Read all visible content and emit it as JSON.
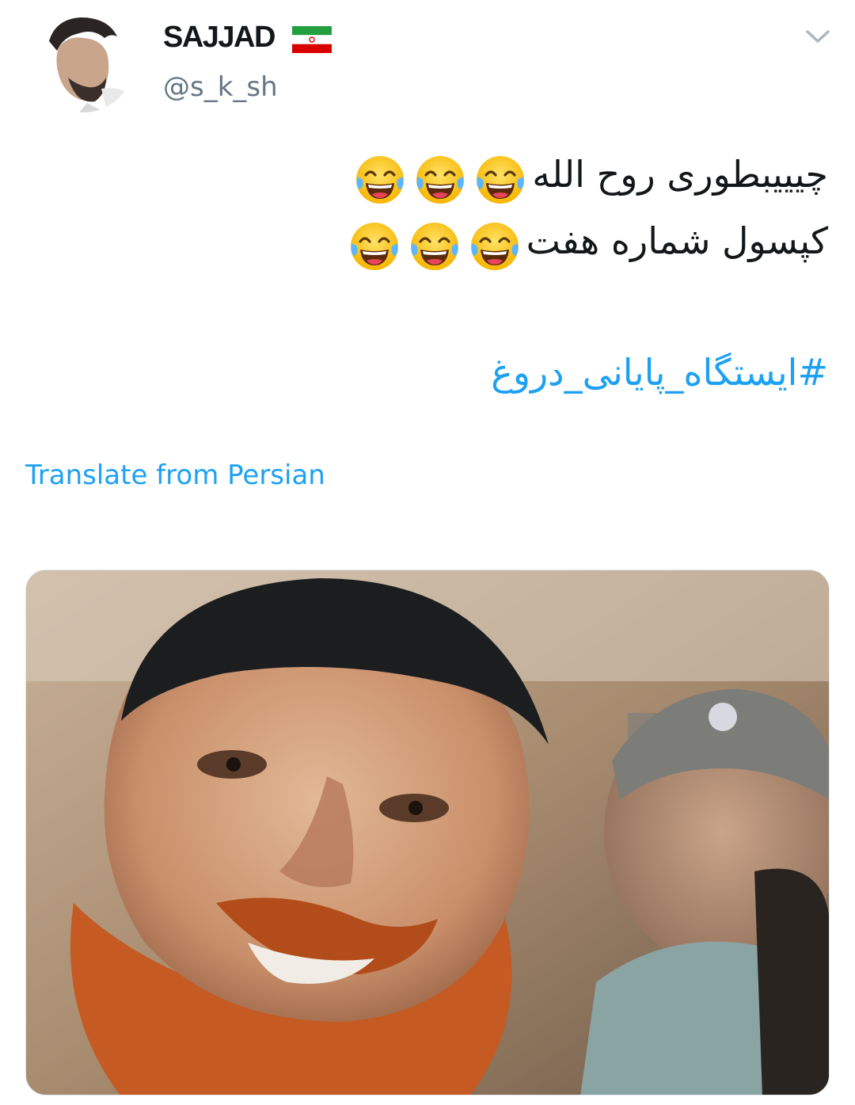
{
  "author": {
    "display_name": "SAJJAD",
    "handle": "@s_k_sh",
    "flag_icon": "iran-flag-icon"
  },
  "menu": {
    "icon": "chevron-down-icon"
  },
  "tweet": {
    "line1": "چیییبطوری روح الله",
    "line2": "کپسول شماره هفت",
    "emoji_icon": "face-with-tears-of-joy-icon",
    "hashtag": "#ایستگاه_پایانی_دروغ"
  },
  "translate_label": "Translate from Persian",
  "colors": {
    "link": "#1da1f2",
    "text": "#14171a",
    "secondary": "#657786",
    "flag_green": "#239f40",
    "flag_red": "#da0000"
  }
}
